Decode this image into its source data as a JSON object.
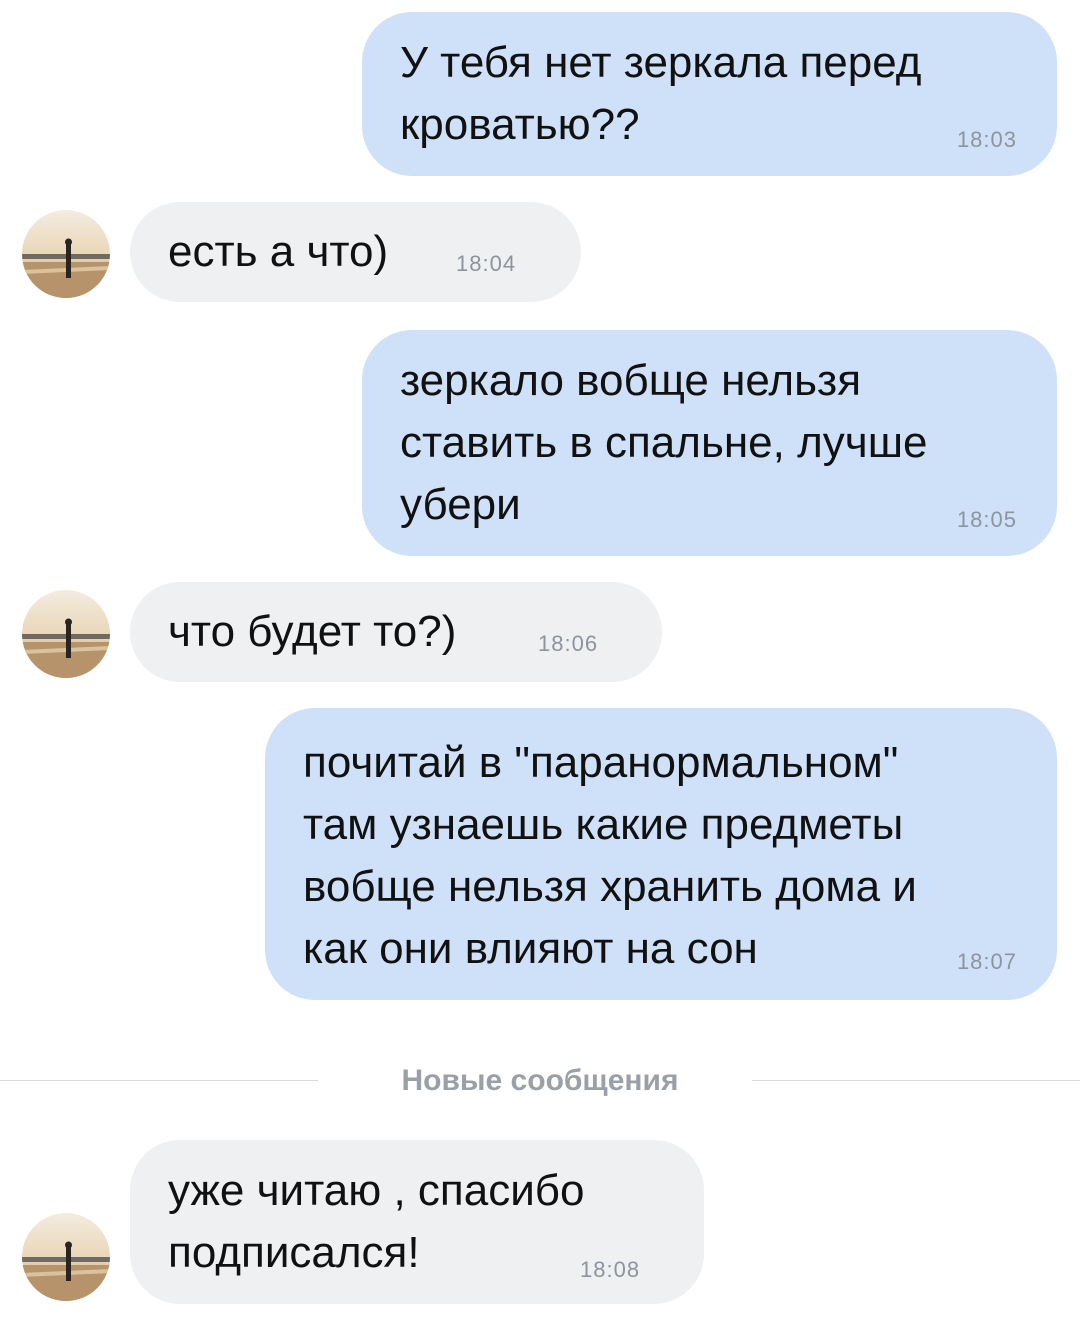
{
  "messages": [
    {
      "direction": "outgoing",
      "text": "У тебя нет зеркала перед\nкроватью??",
      "time": "18:03"
    },
    {
      "direction": "incoming",
      "text": "есть а что)",
      "time": "18:04",
      "avatar": "beach-silhouette-avatar"
    },
    {
      "direction": "outgoing",
      "text": "зеркало вобще нельзя\nставить в спальне, лучше\nубери",
      "time": "18:05"
    },
    {
      "direction": "incoming",
      "text": "что будет то?)",
      "time": "18:06",
      "avatar": "beach-silhouette-avatar"
    },
    {
      "direction": "outgoing",
      "text": "почитай в \"паранормальном\"\nтам узнаешь какие предметы\nвобще нельзя хранить дома и\nкак они влияют на сон",
      "time": "18:07"
    },
    {
      "direction": "incoming",
      "text": "уже читаю , спасибо\nподписался!",
      "time": "18:08",
      "avatar": "beach-silhouette-avatar"
    }
  ],
  "divider": {
    "label": "Новые сообщения"
  },
  "colors": {
    "outgoing_bubble": "#cfe1f8",
    "incoming_bubble": "#eef0f2",
    "timestamp": "#8e949c",
    "divider_text": "#9aa0a7"
  }
}
